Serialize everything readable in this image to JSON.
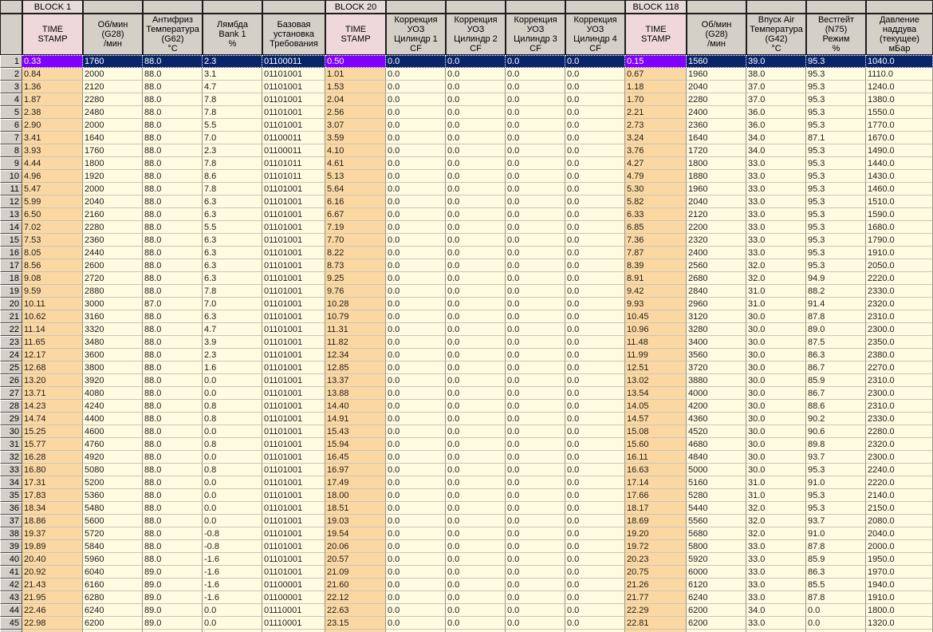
{
  "table": {
    "block_labels": {
      "b1": "BLOCK 1",
      "b20": "BLOCK 20",
      "b118": "BLOCK 118"
    },
    "columns": [
      {
        "id": "row_num",
        "header": ""
      },
      {
        "id": "b1_time",
        "header": "TIME\nSTAMP",
        "block": "BLOCK 1"
      },
      {
        "id": "b1_rpm",
        "header": "Об/мин\n(G28)\n/мин"
      },
      {
        "id": "b1_coolant",
        "header": "Антифриз\nТемпература\n(G62)\n°C"
      },
      {
        "id": "b1_lambda",
        "header": "Лямбда\nBank 1\n%"
      },
      {
        "id": "b1_basic",
        "header": "Базовая\nустановка\nТребования"
      },
      {
        "id": "b20_time",
        "header": "TIME\nSTAMP",
        "block": "BLOCK 20"
      },
      {
        "id": "b20_corr1",
        "header": "Коррекция\nУОЗ\nЦилиндр 1\nCF"
      },
      {
        "id": "b20_corr2",
        "header": "Коррекция\nУОЗ\nЦилиндр 2\nCF"
      },
      {
        "id": "b20_corr3",
        "header": "Коррекция\nУОЗ\nЦилиндр 3\nCF"
      },
      {
        "id": "b20_corr4",
        "header": "Коррекция\nУОЗ\nЦилиндр 4\nCF"
      },
      {
        "id": "b118_time",
        "header": "TIME\nSTAMP",
        "block": "BLOCK 118"
      },
      {
        "id": "b118_rpm",
        "header": "Об/мин\n(G28)\n/мин"
      },
      {
        "id": "b118_iat",
        "header": "Впуск Air\nТемпература\n(G42)\n°C"
      },
      {
        "id": "b118_n75",
        "header": "Вестгейт (N75)\nРежим\n%"
      },
      {
        "id": "b118_boost",
        "header": "Давление\nнаддува\n(текущее)\nмБар"
      }
    ],
    "timestamp_column_indexes": [
      1,
      6,
      11
    ],
    "selection": {
      "row_number": 1
    },
    "rows": [
      [
        "1",
        "0.33",
        "1760",
        "88.0",
        "2.3",
        "01100011",
        "0.50",
        "0.0",
        "0.0",
        "0.0",
        "0.0",
        "0.15",
        "1560",
        "39.0",
        "95.3",
        "1040.0"
      ],
      [
        "2",
        "0.84",
        "2000",
        "88.0",
        "3.1",
        "01101001",
        "1.01",
        "0.0",
        "0.0",
        "0.0",
        "0.0",
        "0.67",
        "1960",
        "38.0",
        "95.3",
        "1110.0"
      ],
      [
        "3",
        "1.36",
        "2120",
        "88.0",
        "4.7",
        "01101001",
        "1.53",
        "0.0",
        "0.0",
        "0.0",
        "0.0",
        "1.18",
        "2040",
        "37.0",
        "95.3",
        "1240.0"
      ],
      [
        "4",
        "1.87",
        "2280",
        "88.0",
        "7.8",
        "01101001",
        "2.04",
        "0.0",
        "0.0",
        "0.0",
        "0.0",
        "1.70",
        "2280",
        "37.0",
        "95.3",
        "1380.0"
      ],
      [
        "5",
        "2.38",
        "2480",
        "88.0",
        "7.8",
        "01101001",
        "2.56",
        "0.0",
        "0.0",
        "0.0",
        "0.0",
        "2.21",
        "2400",
        "36.0",
        "95.3",
        "1550.0"
      ],
      [
        "6",
        "2.90",
        "2000",
        "88.0",
        "5.5",
        "01101001",
        "3.07",
        "0.0",
        "0.0",
        "0.0",
        "0.0",
        "2.73",
        "2360",
        "36.0",
        "95.3",
        "1770.0"
      ],
      [
        "7",
        "3.41",
        "1640",
        "88.0",
        "7.0",
        "01100011",
        "3.59",
        "0.0",
        "0.0",
        "0.0",
        "0.0",
        "3.24",
        "1640",
        "34.0",
        "87.1",
        "1670.0"
      ],
      [
        "8",
        "3.93",
        "1760",
        "88.0",
        "2.3",
        "01100011",
        "4.10",
        "0.0",
        "0.0",
        "0.0",
        "0.0",
        "3.76",
        "1720",
        "34.0",
        "95.3",
        "1490.0"
      ],
      [
        "9",
        "4.44",
        "1800",
        "88.0",
        "7.8",
        "01101011",
        "4.61",
        "0.0",
        "0.0",
        "0.0",
        "0.0",
        "4.27",
        "1800",
        "33.0",
        "95.3",
        "1440.0"
      ],
      [
        "10",
        "4.96",
        "1920",
        "88.0",
        "8.6",
        "01101011",
        "5.13",
        "0.0",
        "0.0",
        "0.0",
        "0.0",
        "4.79",
        "1880",
        "33.0",
        "95.3",
        "1430.0"
      ],
      [
        "11",
        "5.47",
        "2000",
        "88.0",
        "7.8",
        "01101001",
        "5.64",
        "0.0",
        "0.0",
        "0.0",
        "0.0",
        "5.30",
        "1960",
        "33.0",
        "95.3",
        "1460.0"
      ],
      [
        "12",
        "5.99",
        "2040",
        "88.0",
        "6.3",
        "01101001",
        "6.16",
        "0.0",
        "0.0",
        "0.0",
        "0.0",
        "5.82",
        "2040",
        "33.0",
        "95.3",
        "1510.0"
      ],
      [
        "13",
        "6.50",
        "2160",
        "88.0",
        "6.3",
        "01101001",
        "6.67",
        "0.0",
        "0.0",
        "0.0",
        "0.0",
        "6.33",
        "2120",
        "33.0",
        "95.3",
        "1590.0"
      ],
      [
        "14",
        "7.02",
        "2280",
        "88.0",
        "5.5",
        "01101001",
        "7.19",
        "0.0",
        "0.0",
        "0.0",
        "0.0",
        "6.85",
        "2200",
        "33.0",
        "95.3",
        "1680.0"
      ],
      [
        "15",
        "7.53",
        "2360",
        "88.0",
        "6.3",
        "01101001",
        "7.70",
        "0.0",
        "0.0",
        "0.0",
        "0.0",
        "7.36",
        "2320",
        "33.0",
        "95.3",
        "1790.0"
      ],
      [
        "16",
        "8.05",
        "2440",
        "88.0",
        "6.3",
        "01101001",
        "8.22",
        "0.0",
        "0.0",
        "0.0",
        "0.0",
        "7.87",
        "2400",
        "33.0",
        "95.3",
        "1910.0"
      ],
      [
        "17",
        "8.56",
        "2600",
        "88.0",
        "6.3",
        "01101001",
        "8.73",
        "0.0",
        "0.0",
        "0.0",
        "0.0",
        "8.39",
        "2560",
        "32.0",
        "95.3",
        "2050.0"
      ],
      [
        "18",
        "9.08",
        "2720",
        "88.0",
        "6.3",
        "01101001",
        "9.25",
        "0.0",
        "0.0",
        "0.0",
        "0.0",
        "8.91",
        "2680",
        "32.0",
        "94.9",
        "2220.0"
      ],
      [
        "19",
        "9.59",
        "2880",
        "88.0",
        "7.8",
        "01101001",
        "9.76",
        "0.0",
        "0.0",
        "0.0",
        "0.0",
        "9.42",
        "2840",
        "31.0",
        "88.2",
        "2330.0"
      ],
      [
        "20",
        "10.11",
        "3000",
        "87.0",
        "7.0",
        "01101001",
        "10.28",
        "0.0",
        "0.0",
        "0.0",
        "0.0",
        "9.93",
        "2960",
        "31.0",
        "91.4",
        "2320.0"
      ],
      [
        "21",
        "10.62",
        "3160",
        "88.0",
        "6.3",
        "01101001",
        "10.79",
        "0.0",
        "0.0",
        "0.0",
        "0.0",
        "10.45",
        "3120",
        "30.0",
        "87.8",
        "2310.0"
      ],
      [
        "22",
        "11.14",
        "3320",
        "88.0",
        "4.7",
        "01101001",
        "11.31",
        "0.0",
        "0.0",
        "0.0",
        "0.0",
        "10.96",
        "3280",
        "30.0",
        "89.0",
        "2300.0"
      ],
      [
        "23",
        "11.65",
        "3480",
        "88.0",
        "3.9",
        "01101001",
        "11.82",
        "0.0",
        "0.0",
        "0.0",
        "0.0",
        "11.48",
        "3400",
        "30.0",
        "87.5",
        "2350.0"
      ],
      [
        "24",
        "12.17",
        "3600",
        "88.0",
        "2.3",
        "01101001",
        "12.34",
        "0.0",
        "0.0",
        "0.0",
        "0.0",
        "11.99",
        "3560",
        "30.0",
        "86.3",
        "2380.0"
      ],
      [
        "25",
        "12.68",
        "3800",
        "88.0",
        "1.6",
        "01101001",
        "12.85",
        "0.0",
        "0.0",
        "0.0",
        "0.0",
        "12.51",
        "3720",
        "30.0",
        "86.7",
        "2270.0"
      ],
      [
        "26",
        "13.20",
        "3920",
        "88.0",
        "0.0",
        "01101001",
        "13.37",
        "0.0",
        "0.0",
        "0.0",
        "0.0",
        "13.02",
        "3880",
        "30.0",
        "85.9",
        "2310.0"
      ],
      [
        "27",
        "13.71",
        "4080",
        "88.0",
        "0.0",
        "01101001",
        "13.88",
        "0.0",
        "0.0",
        "0.0",
        "0.0",
        "13.54",
        "4000",
        "30.0",
        "86.7",
        "2300.0"
      ],
      [
        "28",
        "14.23",
        "4240",
        "88.0",
        "0.8",
        "01101001",
        "14.40",
        "0.0",
        "0.0",
        "0.0",
        "0.0",
        "14.05",
        "4200",
        "30.0",
        "88.6",
        "2310.0"
      ],
      [
        "29",
        "14.74",
        "4400",
        "88.0",
        "0.8",
        "01101001",
        "14.91",
        "0.0",
        "0.0",
        "0.0",
        "0.0",
        "14.57",
        "4360",
        "30.0",
        "90.2",
        "2330.0"
      ],
      [
        "30",
        "15.25",
        "4600",
        "88.0",
        "0.0",
        "01101001",
        "15.43",
        "0.0",
        "0.0",
        "0.0",
        "0.0",
        "15.08",
        "4520",
        "30.0",
        "90.6",
        "2280.0"
      ],
      [
        "31",
        "15.77",
        "4760",
        "88.0",
        "0.8",
        "01101001",
        "15.94",
        "0.0",
        "0.0",
        "0.0",
        "0.0",
        "15.60",
        "4680",
        "30.0",
        "89.8",
        "2320.0"
      ],
      [
        "32",
        "16.28",
        "4920",
        "88.0",
        "0.0",
        "01101001",
        "16.45",
        "0.0",
        "0.0",
        "0.0",
        "0.0",
        "16.11",
        "4840",
        "30.0",
        "93.7",
        "2300.0"
      ],
      [
        "33",
        "16.80",
        "5080",
        "88.0",
        "0.8",
        "01101001",
        "16.97",
        "0.0",
        "0.0",
        "0.0",
        "0.0",
        "16.63",
        "5000",
        "30.0",
        "95.3",
        "2240.0"
      ],
      [
        "34",
        "17.31",
        "5200",
        "88.0",
        "0.0",
        "01101001",
        "17.49",
        "0.0",
        "0.0",
        "0.0",
        "0.0",
        "17.14",
        "5160",
        "31.0",
        "91.0",
        "2220.0"
      ],
      [
        "35",
        "17.83",
        "5360",
        "88.0",
        "0.0",
        "01101001",
        "18.00",
        "0.0",
        "0.0",
        "0.0",
        "0.0",
        "17.66",
        "5280",
        "31.0",
        "95.3",
        "2140.0"
      ],
      [
        "36",
        "18.34",
        "5480",
        "88.0",
        "0.0",
        "01101001",
        "18.51",
        "0.0",
        "0.0",
        "0.0",
        "0.0",
        "18.17",
        "5440",
        "32.0",
        "95.3",
        "2150.0"
      ],
      [
        "37",
        "18.86",
        "5600",
        "88.0",
        "0.0",
        "01101001",
        "19.03",
        "0.0",
        "0.0",
        "0.0",
        "0.0",
        "18.69",
        "5560",
        "32.0",
        "93.7",
        "2080.0"
      ],
      [
        "38",
        "19.37",
        "5720",
        "88.0",
        "-0.8",
        "01101001",
        "19.54",
        "0.0",
        "0.0",
        "0.0",
        "0.0",
        "19.20",
        "5680",
        "32.0",
        "91.0",
        "2040.0"
      ],
      [
        "39",
        "19.89",
        "5840",
        "88.0",
        "-0.8",
        "01101001",
        "20.06",
        "0.0",
        "0.0",
        "0.0",
        "0.0",
        "19.72",
        "5800",
        "33.0",
        "87.8",
        "2000.0"
      ],
      [
        "40",
        "20.40",
        "5960",
        "88.0",
        "-1.6",
        "01101001",
        "20.57",
        "0.0",
        "0.0",
        "0.0",
        "0.0",
        "20.23",
        "5920",
        "33.0",
        "85.9",
        "1950.0"
      ],
      [
        "41",
        "20.92",
        "6040",
        "89.0",
        "-1.6",
        "01101001",
        "21.09",
        "0.0",
        "0.0",
        "0.0",
        "0.0",
        "20.75",
        "6000",
        "33.0",
        "86.3",
        "1970.0"
      ],
      [
        "42",
        "21.43",
        "6160",
        "89.0",
        "-1.6",
        "01100001",
        "21.60",
        "0.0",
        "0.0",
        "0.0",
        "0.0",
        "21.26",
        "6120",
        "33.0",
        "85.5",
        "1940.0"
      ],
      [
        "43",
        "21.95",
        "6280",
        "89.0",
        "-1.6",
        "01100001",
        "22.12",
        "0.0",
        "0.0",
        "0.0",
        "0.0",
        "21.77",
        "6240",
        "33.0",
        "87.8",
        "1910.0"
      ],
      [
        "44",
        "22.46",
        "6240",
        "89.0",
        "0.0",
        "01110001",
        "22.63",
        "0.0",
        "0.0",
        "0.0",
        "0.0",
        "22.29",
        "6200",
        "34.0",
        "0.0",
        "1800.0"
      ],
      [
        "45",
        "22.98",
        "6200",
        "89.0",
        "0.0",
        "01110001",
        "23.15",
        "0.0",
        "0.0",
        "0.0",
        "0.0",
        "22.81",
        "6200",
        "33.0",
        "0.0",
        "1320.0"
      ]
    ]
  },
  "colors": {
    "chrome_gray": "#d4d0c8",
    "header_pink": "#f0d8da",
    "block_label_pink": "#e8dcd8",
    "timestamp_orange": "#fbd8a2",
    "cell_cream": "#fffbe0",
    "selected_navy": "#0a246a",
    "selected_timestamp_violet": "#8000ff",
    "selected_text": "#ffffff",
    "grid_vertical": "#969288",
    "grid_horizontal": "#cac6b8"
  }
}
